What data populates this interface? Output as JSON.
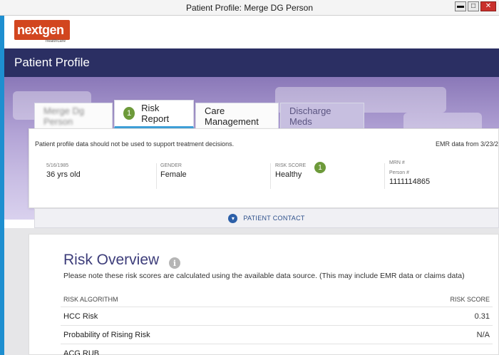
{
  "window": {
    "title": "Patient Profile: Merge DG Person",
    "controls": {
      "minimize": "▬",
      "maximize": "□",
      "close": "✕"
    }
  },
  "brand": {
    "logo_text": "nextgen",
    "logo_sub": "healthcare"
  },
  "header": {
    "title": "Patient Profile"
  },
  "tabs": [
    {
      "label": "Merge Dg Person",
      "state": "blurred"
    },
    {
      "label": "Risk Report",
      "state": "active",
      "badge": "1"
    },
    {
      "label": "Care Management",
      "state": "normal"
    },
    {
      "label": "Discharge Meds",
      "state": "disabled"
    }
  ],
  "summary": {
    "disclaimer": "Patient profile data should not be used to support treatment decisions.",
    "emr_data": "EMR data from 3/23/2",
    "fields": {
      "dob_label": "5/16/1985",
      "age": "36 yrs old",
      "gender_label": "GENDER",
      "gender": "Female",
      "risk_label": "RISK SCORE",
      "risk_badge": "1",
      "risk_value": "Healthy",
      "mrn_label": "MRN #",
      "person_label": "Person #",
      "person_value": "1111114865"
    }
  },
  "contact": {
    "label": "PATIENT CONTACT",
    "icon": "chevron-down-icon"
  },
  "overview": {
    "title": "Risk Overview",
    "info_icon": "i",
    "note": "Please note these risk scores are calculated using the available data source. (This may include EMR data or claims data)",
    "columns": [
      "RISK ALGORITHM",
      "RISK SCORE"
    ],
    "rows": [
      {
        "name": "HCC Risk",
        "score": "0.31"
      },
      {
        "name": "Probability of Rising Risk",
        "score": "N/A"
      },
      {
        "name": "ACG RUB",
        "score": ""
      }
    ]
  },
  "colors": {
    "accent": "#3fa0d8",
    "header": "#2b2f63",
    "badge": "#6d9a3a",
    "brand": "#d2461f"
  }
}
